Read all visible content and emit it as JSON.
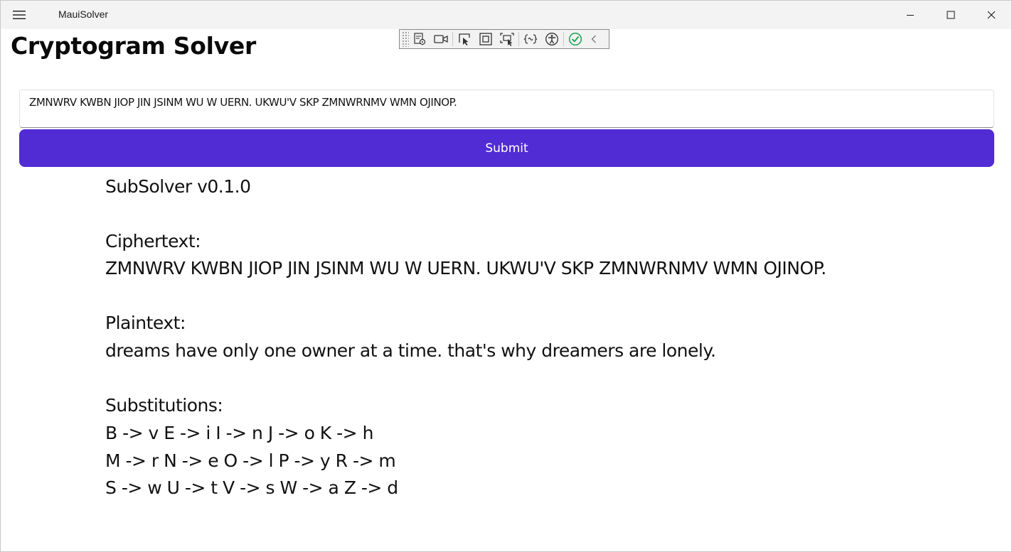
{
  "window": {
    "title": "MauiSolver"
  },
  "icons": {
    "menu": "hamburger-menu-icon",
    "minimize": "minimize-icon",
    "maximize": "maximize-icon",
    "close": "close-icon"
  },
  "debug_toolbar": {
    "tools": [
      "live-visual-tree-icon",
      "record-icon",
      "select-element-icon",
      "display-layout-adorners-icon",
      "track-focus-icon",
      "binding-failures-icon",
      "accessibility-checker-icon",
      "no-issues-check-icon",
      "collapse-chevron-icon"
    ]
  },
  "page": {
    "title": "Cryptogram Solver"
  },
  "input": {
    "value": "ZMNWRV KWBN JIOP JIN JSINM WU W UERN. UKWU'V SKP ZMNWRNMV WMN OJINOP."
  },
  "submit": {
    "label": "Submit"
  },
  "output": {
    "version": "SubSolver v0.1.0",
    "ciphertext_label": "Ciphertext:",
    "ciphertext": "ZMNWRV KWBN JIOP JIN JSINM WU W UERN. UKWU'V SKP ZMNWRNMV WMN OJINOP.",
    "plaintext_label": "Plaintext:",
    "plaintext": "dreams have only one owner at a time. that's why dreamers are lonely.",
    "substitutions_label": "Substitutions:",
    "substitution_lines": [
      "B -> v E -> i I -> n J -> o K -> h",
      "M -> r N -> e O -> l P -> y R -> m",
      "S -> w U -> t V -> s W -> a Z -> d"
    ]
  },
  "colors": {
    "accent": "#512bd4",
    "titlebar": "#f3f3f3",
    "check": "#16a34a"
  }
}
